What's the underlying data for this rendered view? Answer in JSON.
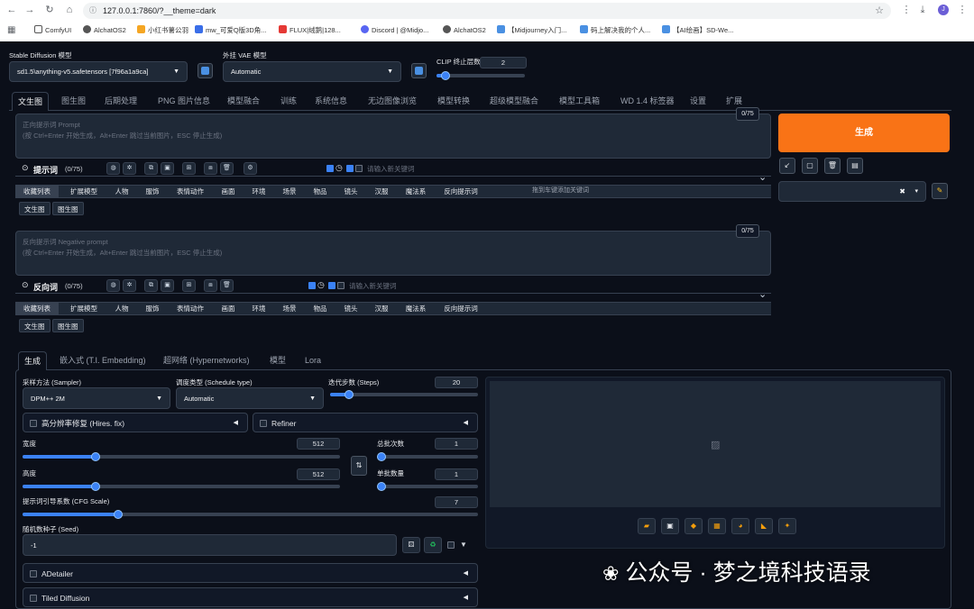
{
  "browser": {
    "url": "127.0.0.1:7860/?__theme=dark",
    "bookmarks": [
      "ComfyUI",
      "AlchatOS2",
      "小红书薯公羽",
      "mw_可爱Q版3D角...",
      "FLUX|绒鹅|128...",
      "Discord | @Midjo...",
      "AlchatOS2",
      "【Midjourney入门...",
      "码上解决我的个人...",
      "【AI绘画】SD-We..."
    ]
  },
  "top": {
    "sd_model_label": "Stable Diffusion 模型",
    "sd_model_value": "sd1.5\\anything-v5.safetensors [7f96a1a9ca]",
    "vae_label": "外挂 VAE 模型",
    "vae_value": "Automatic",
    "clip_label": "CLIP 终止层数",
    "clip_value": "2",
    "clip_fraction": 0.1
  },
  "main_tabs": [
    "文生图",
    "图生图",
    "后期处理",
    "PNG 图片信息",
    "模型融合",
    "训练",
    "系统信息",
    "无边图像浏览",
    "模型转换",
    "超级模型融合",
    "模型工具箱",
    "WD 1.4 标签器",
    "设置",
    "扩展"
  ],
  "prompt": {
    "placeholder_line1": "正向提示词 Prompt",
    "placeholder_line2": "(按 Ctrl+Enter 开始生成，Alt+Enter 跳过当前图片，ESC 停止生成)",
    "counter": "0/75",
    "helper_label": "提示词",
    "helper_count": "(0/75)",
    "keyword_placeholder": "请输入新关键词",
    "hint": "拖到车键添加关键词"
  },
  "negative": {
    "placeholder_line1": "反向提示词 Negative prompt",
    "placeholder_line2": "(按 Ctrl+Enter 开始生成，Alt+Enter 跳过当前图片，ESC 停止生成)",
    "counter": "0/75",
    "helper_label": "反向词",
    "helper_count": "(0/75)",
    "keyword_placeholder": "请输入新关键词"
  },
  "categories": [
    "收藏列表",
    "扩展模型",
    "人物",
    "服饰",
    "表情动作",
    "画面",
    "环境",
    "场景",
    "物品",
    "镜头",
    "汉服",
    "魔法系",
    "反向提示词"
  ],
  "neg_categories": [
    "收藏列表",
    "扩展模型",
    "人物",
    "服饰",
    "表情动作",
    "画面",
    "环境",
    "场景",
    "物品",
    "镜头",
    "汉服",
    "魔法系",
    "反向提示词"
  ],
  "subtabs": [
    "文生图",
    "图生图"
  ],
  "generate": {
    "label": "生成"
  },
  "params_tabs": [
    "生成",
    "嵌入式 (T.I. Embedding)",
    "超网络 (Hypernetworks)",
    "模型",
    "Lora"
  ],
  "params": {
    "sampler_label": "采样方法 (Sampler)",
    "sampler_value": "DPM++ 2M",
    "schedule_label": "调度类型 (Schedule type)",
    "schedule_value": "Automatic",
    "steps_label": "迭代步数 (Steps)",
    "steps_value": "20",
    "steps_fraction": 0.13,
    "hires_label": "高分辨率修复 (Hires. fix)",
    "refiner_label": "Refiner",
    "width_label": "宽度",
    "width_value": "512",
    "width_fraction": 0.23,
    "height_label": "高度",
    "height_value": "512",
    "height_fraction": 0.23,
    "batch_count_label": "总批次数",
    "batch_count_value": "1",
    "batch_size_label": "单批数量",
    "batch_size_value": "1",
    "cfg_label": "提示词引导系数 (CFG Scale)",
    "cfg_value": "7",
    "cfg_fraction": 0.21,
    "seed_label": "随机数种子 (Seed)",
    "seed_value": "-1",
    "adetailer_label": "ADetailer",
    "tiled_label": "Tiled Diffusion"
  },
  "watermark": "公众号 · 梦之境科技语录",
  "colors": {
    "accent": "#f97316",
    "bg": "#0b0f19",
    "panel": "#1f2937",
    "blue": "#3b82f6"
  }
}
